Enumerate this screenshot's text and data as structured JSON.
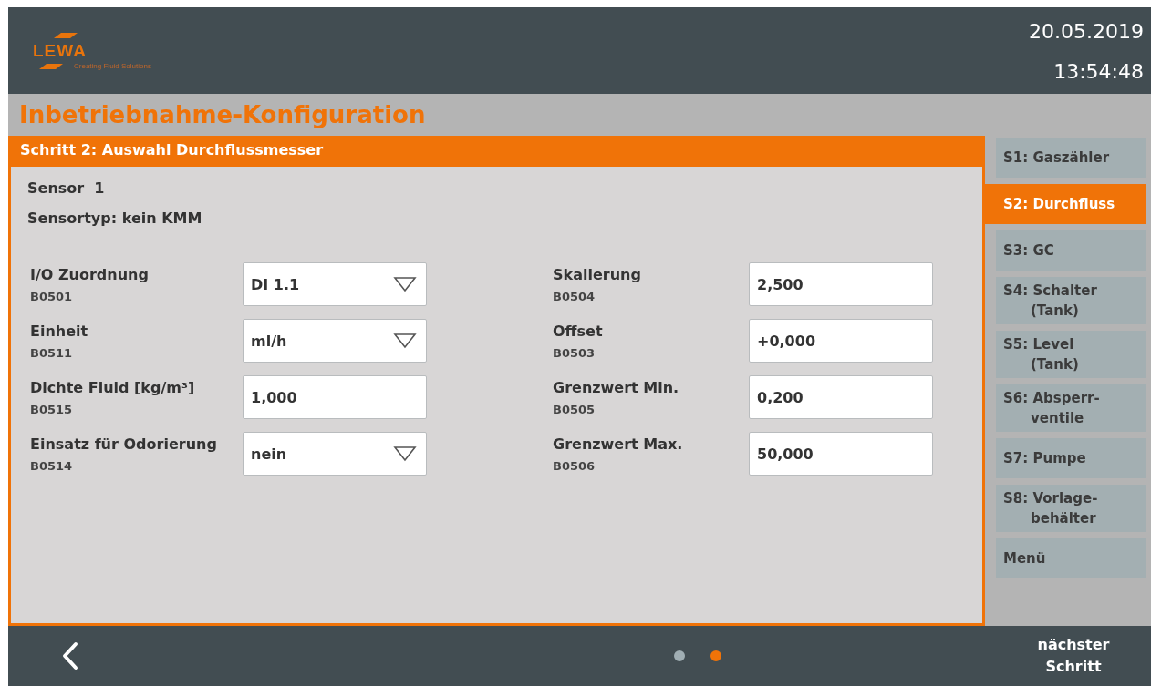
{
  "header": {
    "logo": {
      "name": "LEWA",
      "tagline": "Creating Fluid Solutions"
    },
    "date": "20.05.2019",
    "time": "13:54:48"
  },
  "title": "Inbetriebnahme-Konfiguration",
  "panel": {
    "heading": "Schritt 2: Auswahl Durchflussmesser",
    "info": [
      "Sensor  1",
      "Sensortyp: kein KMM"
    ],
    "columns": [
      {
        "fields": [
          {
            "label": "I/O Zuordnung",
            "code": "B0501",
            "kind": "dropdown",
            "value": "DI 1.1"
          },
          {
            "label": "Einheit",
            "code": "B0511",
            "kind": "dropdown",
            "value": "ml/h"
          },
          {
            "label": "Dichte Fluid [kg/m³]",
            "code": "B0515",
            "kind": "input",
            "value": "1,000"
          },
          {
            "label": "Einsatz für Odorierung",
            "code": "B0514",
            "kind": "dropdown",
            "value": "nein"
          }
        ]
      },
      {
        "fields": [
          {
            "label": "Skalierung",
            "code": "B0504",
            "kind": "input",
            "value": "2,500"
          },
          {
            "label": "Offset",
            "code": "B0503",
            "kind": "input",
            "value": "+0,000"
          },
          {
            "label": "Grenzwert Min.",
            "code": "B0505",
            "kind": "input",
            "value": "0,200"
          },
          {
            "label": "Grenzwert Max.",
            "code": "B0506",
            "kind": "input",
            "value": "50,000"
          }
        ]
      }
    ]
  },
  "sidebar": {
    "items": [
      {
        "label": "S1: Gaszähler",
        "selected": false
      },
      {
        "label": "S2: Durchfluss",
        "selected": true
      },
      {
        "label": "S3: GC",
        "selected": false
      },
      {
        "label": "S4: Schalter (Tank)",
        "selected": false
      },
      {
        "label": "S5: Level (Tank)",
        "selected": false
      },
      {
        "label": "S6: Absperr-ventile",
        "selected": false
      },
      {
        "label": "S7: Pumpe",
        "selected": false
      },
      {
        "label": "S8: Vorlage-behälter",
        "selected": false
      },
      {
        "label": "Menü",
        "selected": false
      }
    ]
  },
  "footer": {
    "pages": [
      {
        "selected": false
      },
      {
        "selected": true
      }
    ],
    "next_button": "nächster Schritt"
  }
}
